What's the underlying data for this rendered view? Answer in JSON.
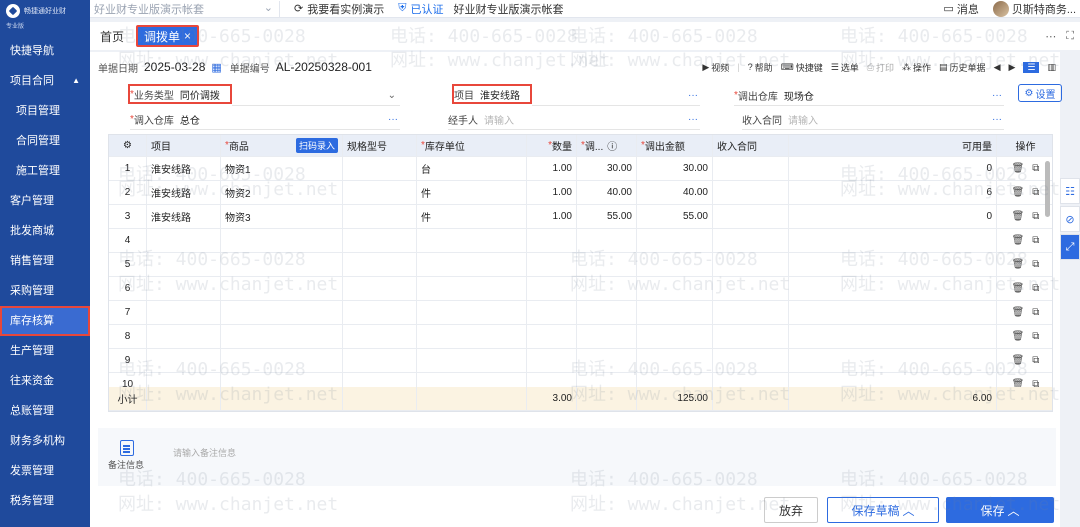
{
  "sidebar": {
    "logo_text": "畅捷通好业财",
    "logo_sub": "专业版",
    "items": [
      {
        "label": "快捷导航"
      },
      {
        "label": "项目合同",
        "expanded": true
      },
      {
        "label": "项目管理"
      },
      {
        "label": "合同管理"
      },
      {
        "label": "施工管理"
      },
      {
        "label": "客户管理"
      },
      {
        "label": "批发商城"
      },
      {
        "label": "销售管理"
      },
      {
        "label": "采购管理"
      },
      {
        "label": "库存核算",
        "active": true
      },
      {
        "label": "生产管理"
      },
      {
        "label": "往来资金"
      },
      {
        "label": "总账管理"
      },
      {
        "label": "财务多机构"
      },
      {
        "label": "发票管理"
      },
      {
        "label": "税务管理"
      }
    ]
  },
  "topbar": {
    "account_select": "好业财专业版演示帐套",
    "demo_link": "我要看实例演示",
    "cert_label": "已认证",
    "cert_sub": "好业财专业版演示帐套",
    "message_label": "消息",
    "user_name": "贝斯特商务..."
  },
  "tabs": {
    "home": "首页",
    "active": "调拨单",
    "close_glyph": "×"
  },
  "info": {
    "date_label": "单据日期",
    "date_value": "2025-03-28",
    "code_label": "单据编号",
    "code_value": "AL-20250328-001"
  },
  "toolbar": {
    "video": "视频",
    "help": "帮助",
    "shortcut": "快捷键",
    "select_doc": "选单",
    "print": "打印",
    "operate": "操作",
    "history": "历史单据"
  },
  "form": {
    "biz_type_label": "业务类型",
    "biz_type_value": "同价调拨",
    "project_label": "项目",
    "project_value": "淮安线路",
    "out_wh_label": "调出仓库",
    "out_wh_value": "现场仓",
    "in_wh_label": "调入仓库",
    "in_wh_value": "总仓",
    "handler_label": "经手人",
    "handler_placeholder": "请输入",
    "contract_label": "收入合同",
    "contract_placeholder": "请输入",
    "settings_label": "设置"
  },
  "grid": {
    "headers": {
      "project": "项目",
      "product": "商品",
      "scan": "扫码录入",
      "spec": "规格型号",
      "unit": "库存单位",
      "qty": "数量",
      "price": "调...",
      "amount": "调出金额",
      "contract": "收入合同",
      "available": "可用量",
      "ops": "操作"
    },
    "rows": [
      {
        "no": "1",
        "project": "淮安线路",
        "product": "物资1",
        "unit": "台",
        "qty": "1.00",
        "price": "30.00",
        "amount": "30.00",
        "available": "0"
      },
      {
        "no": "2",
        "project": "淮安线路",
        "product": "物资2",
        "unit": "件",
        "qty": "1.00",
        "price": "40.00",
        "amount": "40.00",
        "available": "6"
      },
      {
        "no": "3",
        "project": "淮安线路",
        "product": "物资3",
        "unit": "件",
        "qty": "1.00",
        "price": "55.00",
        "amount": "55.00",
        "available": "0"
      },
      {
        "no": "4"
      },
      {
        "no": "5"
      },
      {
        "no": "6"
      },
      {
        "no": "7"
      },
      {
        "no": "8"
      },
      {
        "no": "9"
      },
      {
        "no": "10"
      }
    ],
    "subtotal": {
      "label": "小计",
      "qty": "3.00",
      "amount": "125.00",
      "available": "6.00"
    }
  },
  "notes": {
    "label": "备注信息",
    "placeholder": "请输入备注信息"
  },
  "buttons": {
    "abandon": "放弃",
    "save_draft": "保存草稿",
    "save": "保存"
  },
  "watermark": {
    "phone": "电话: 400-665-0028",
    "site": "网址: www.chanjet.net"
  }
}
